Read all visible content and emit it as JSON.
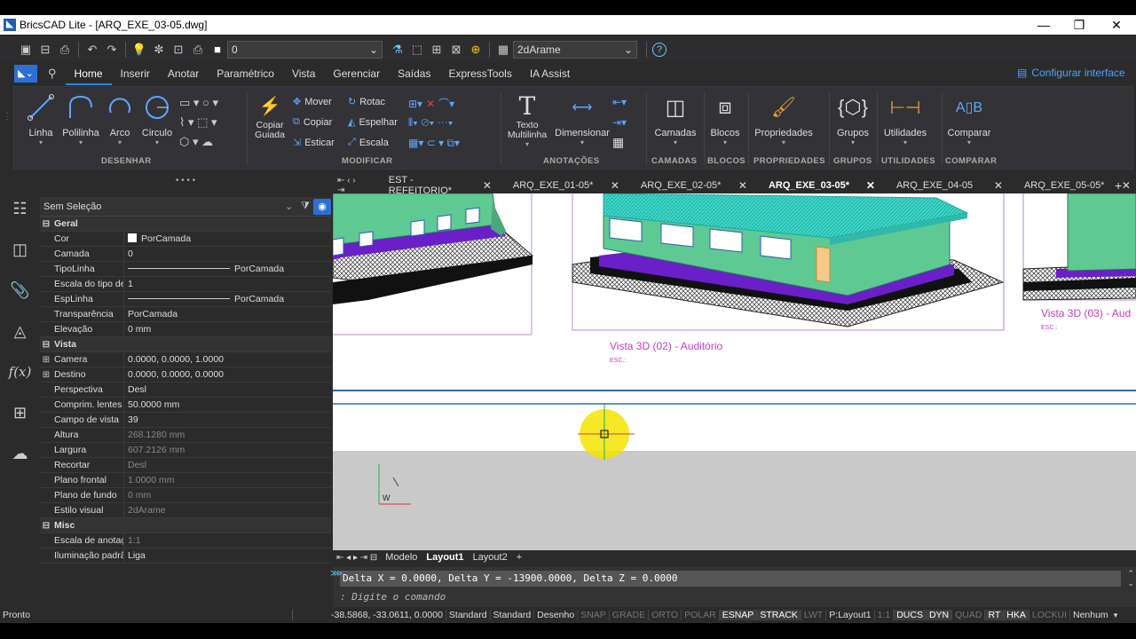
{
  "window": {
    "title": "BricsCAD Lite - [ARQ_EXE_03-05.dwg]",
    "minimize": "—",
    "maximize": "❐",
    "close": "✕"
  },
  "qat": {
    "layer_value": "0",
    "visual_style_value": "2dArame",
    "help_icon": "?"
  },
  "ribbon_tabs": [
    "Home",
    "Inserir",
    "Anotar",
    "Paramétrico",
    "Vista",
    "Gerenciar",
    "Saídas",
    "ExpressTools",
    "IA Assist"
  ],
  "configure_link": "Configurar interface",
  "ribbon": {
    "desenhar": {
      "linha": "Linha",
      "polilinha": "Polilinha",
      "arco": "Arco",
      "circulo": "Circulo",
      "group": "DESENHAR"
    },
    "modificar": {
      "copiar_guiada": "Copiar Guiada",
      "mover": "Mover",
      "copiar": "Copiar",
      "esticar": "Esticar",
      "rotac": "Rotac",
      "espelhar": "Espelhar",
      "escala": "Escala",
      "group": "MODIFICAR"
    },
    "anotacoes": {
      "texto_multilinha": "Texto Multilinha",
      "dimensionar": "Dimensionar",
      "group": "ANOTAÇÕES"
    },
    "camadas": {
      "label": "Camadas",
      "group": "CAMADAS"
    },
    "blocos": {
      "label": "Blocos",
      "group": "BLOCOS"
    },
    "propriedades": {
      "label": "Propriedades",
      "group": "PROPRIEDADES"
    },
    "grupos": {
      "label": "Grupos",
      "group": "GRUPOS"
    },
    "utilidades": {
      "label": "Utilidades",
      "group": "UTILIDADES"
    },
    "comparar": {
      "label": "Comparar",
      "group": "COMPARAR"
    }
  },
  "properties": {
    "grip": "• • • •",
    "selection": "Sem Seleção",
    "sections": [
      {
        "title": "Geral",
        "rows": [
          {
            "name": "Cor",
            "value": "PorCamada",
            "swatch": true
          },
          {
            "name": "Camada",
            "value": "0"
          },
          {
            "name": "TipoLinha",
            "value": "PorCamada",
            "line": true
          },
          {
            "name": "Escala do tipo de",
            "value": "1"
          },
          {
            "name": "EspLinha",
            "value": "PorCamada",
            "line": true
          },
          {
            "name": "Transparência",
            "value": "PorCamada"
          },
          {
            "name": "Elevação",
            "value": "0 mm"
          }
        ]
      },
      {
        "title": "Vista",
        "rows": [
          {
            "name": "Camera",
            "value": "0.0000, 0.0000, 1.0000",
            "expand": true
          },
          {
            "name": "Destino",
            "value": "0.0000, 0.0000, 0.0000",
            "expand": true
          },
          {
            "name": "Perspectiva",
            "value": "Desl"
          },
          {
            "name": "Comprim. lentes",
            "value": "50.0000 mm"
          },
          {
            "name": "Campo de vista",
            "value": "39"
          },
          {
            "name": "Altura",
            "value": "268.1280 mm",
            "dim": true
          },
          {
            "name": "Largura",
            "value": "607.2126 mm",
            "dim": true
          },
          {
            "name": "Recortar",
            "value": "Desl",
            "dim": true
          },
          {
            "name": "Plano frontal",
            "value": "1.0000 mm",
            "dim": true
          },
          {
            "name": "Plano de fundo",
            "value": "0 mm",
            "dim": true
          },
          {
            "name": "Estilo visual",
            "value": "2dArame",
            "dim": true
          }
        ]
      },
      {
        "title": "Misc",
        "rows": [
          {
            "name": "Escala de anotaç",
            "value": "1:1",
            "dim": true
          },
          {
            "name": "Iluminação padrã",
            "value": "Liga"
          }
        ]
      }
    ]
  },
  "doc_tabs": [
    {
      "label": "EST - REFEITORIO*",
      "active": false
    },
    {
      "label": "ARQ_EXE_01-05*",
      "active": false
    },
    {
      "label": "ARQ_EXE_02-05*",
      "active": false
    },
    {
      "label": "ARQ_EXE_03-05*",
      "active": true
    },
    {
      "label": "ARQ_EXE_04-05",
      "active": false
    },
    {
      "label": "ARQ_EXE_05-05*",
      "active": false
    }
  ],
  "canvas": {
    "view2_title": "Vista 3D (02) - Auditório",
    "view2_scale": "ESC.:",
    "view3_title": "Vista 3D (03) - Aud",
    "view3_scale": "ESC.:",
    "ucs_label": "W"
  },
  "layout_tabs": [
    "Modelo",
    "Layout1",
    "Layout2",
    "+"
  ],
  "active_layout": "Layout1",
  "command": {
    "history": "Delta X = 0.0000,  Delta Y = -13900.0000,  Delta Z = 0.0000",
    "prompt": ": Digite o comando"
  },
  "status": {
    "ready": "Pronto",
    "coords": "-38.5868, -33.0611, 0.0000",
    "items": [
      {
        "t": "Standard",
        "s": "n"
      },
      {
        "t": "Standard",
        "s": "n"
      },
      {
        "t": "Desenho",
        "s": "n"
      },
      {
        "t": "SNAP",
        "s": "off"
      },
      {
        "t": "GRADE",
        "s": "off"
      },
      {
        "t": "ORTO",
        "s": "off"
      },
      {
        "t": "POLAR",
        "s": "off"
      },
      {
        "t": "ESNAP",
        "s": "on"
      },
      {
        "t": "STRACK",
        "s": "on"
      },
      {
        "t": "LWT",
        "s": "off"
      },
      {
        "t": "P:Layout1",
        "s": "n"
      },
      {
        "t": "1:1",
        "s": "off"
      },
      {
        "t": "DUCS",
        "s": "on"
      },
      {
        "t": "DYN",
        "s": "on"
      },
      {
        "t": "QUAD",
        "s": "off"
      },
      {
        "t": "RT",
        "s": "on"
      },
      {
        "t": "HKA",
        "s": "on"
      },
      {
        "t": "LOCKUI",
        "s": "off"
      },
      {
        "t": "Nenhum",
        "s": "n"
      }
    ]
  },
  "colors": {
    "building_green": "#5ec993",
    "roof_cyan": "#3fd6c8",
    "band_purple": "#6a1fc9",
    "title_magenta": "#c03fbf",
    "highlight_yellow": "#f5e400"
  }
}
